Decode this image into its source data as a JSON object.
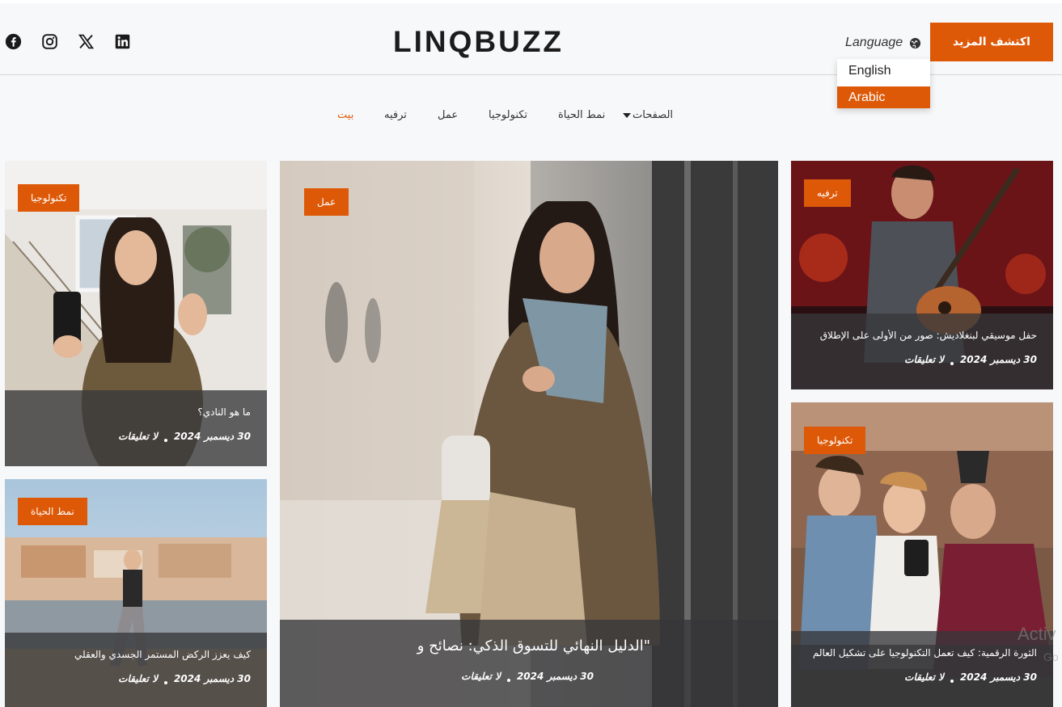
{
  "header": {
    "logo": "LINQBUZZ",
    "language_label": "Language",
    "cta_label": "اكتشف المزيد",
    "social": [
      "facebook-icon",
      "instagram-icon",
      "x-twitter-icon",
      "linkedin-icon"
    ]
  },
  "language_menu": {
    "options": [
      "English",
      "Arabic"
    ],
    "selected": "Arabic"
  },
  "nav": {
    "items": [
      "بيت",
      "ترفيه",
      "عمل",
      "تكنولوجيا",
      "نمط الحياة",
      "الصفحات"
    ],
    "active": "بيت"
  },
  "cards": {
    "left_top": {
      "badge": "تكنولوجيا",
      "title": "ما هو النادي؟",
      "date": "30 ديسمبر 2024",
      "comments": "لا تعليقات"
    },
    "left_bottom": {
      "badge": "نمط الحياة",
      "title": "كيف يعزز الركض المستمر الجسدي والعقلي",
      "date": "30 ديسمبر 2024",
      "comments": "لا تعليقات"
    },
    "center": {
      "badge": "عمل",
      "title": "\"الدليل النهائي للتسوق الذكي: نصائح و",
      "date": "30 ديسمبر 2024",
      "comments": "لا تعليقات"
    },
    "right_top": {
      "badge": "ترفيه",
      "title": "حفل موسيقي لبنغلاديش: صور من الأولى على الإطلاق",
      "date": "30 ديسمبر 2024",
      "comments": "لا تعليقات"
    },
    "right_bottom": {
      "badge": "تكنولوجيا",
      "title": "الثورة الرقمية: كيف تعمل التكنولوجيا على تشكيل العالم",
      "date": "30 ديسمبر 2024",
      "comments": "لا تعليقات"
    }
  },
  "watermark": {
    "line1": "Activ",
    "line2": "Go to S"
  },
  "colors": {
    "accent": "#dd5908",
    "overlay": "#37373a"
  }
}
